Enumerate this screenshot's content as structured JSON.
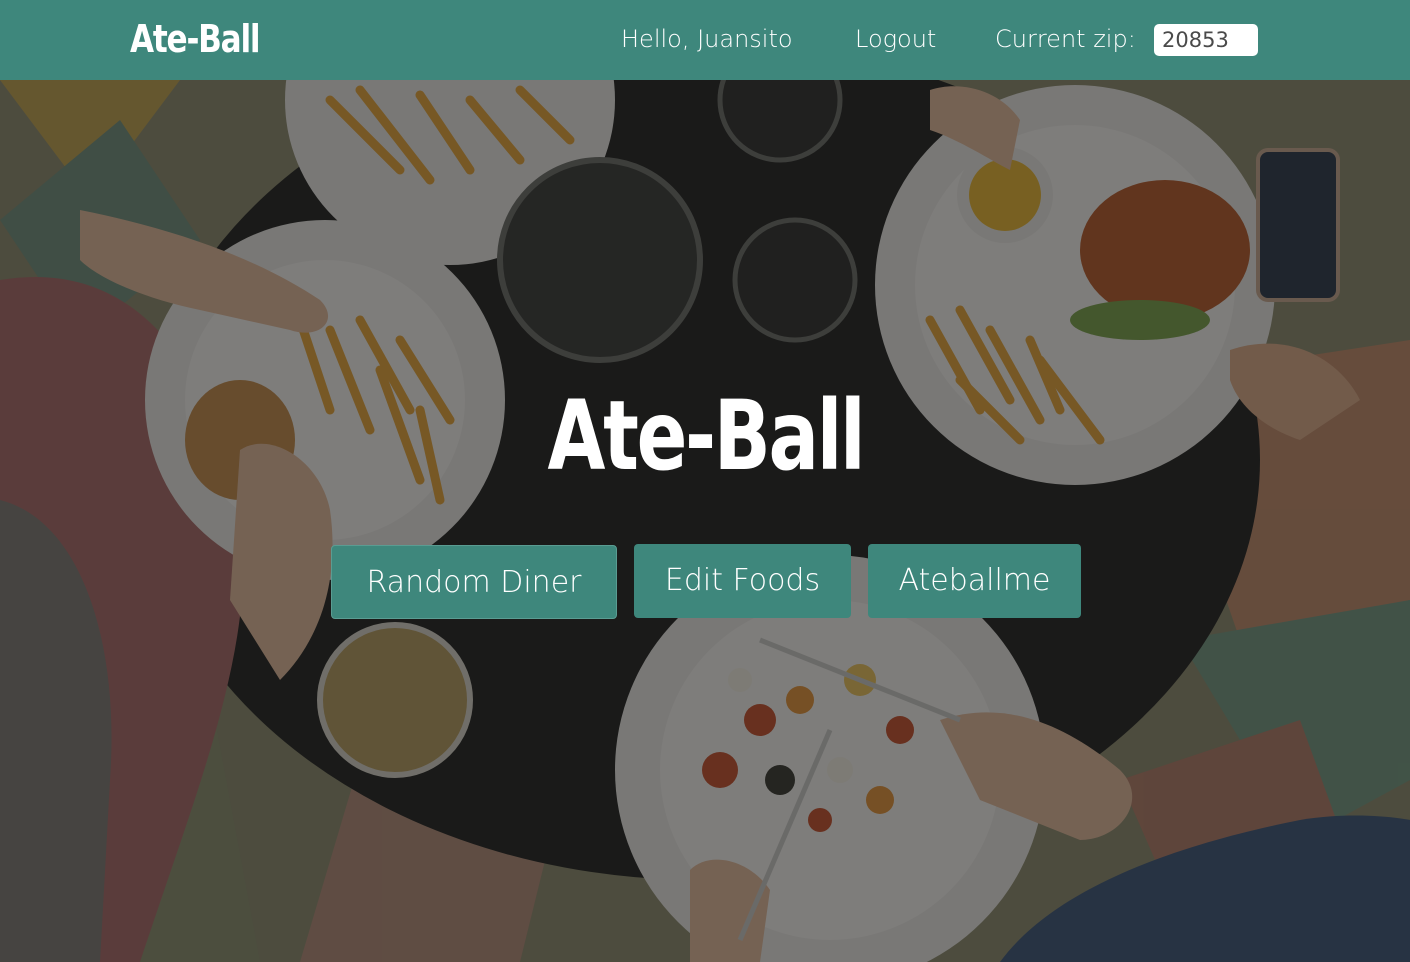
{
  "navbar": {
    "brand": "Ate-Ball",
    "greeting": "Hello, Juansito",
    "logout_label": "Logout",
    "zip_label": "Current zip:",
    "zip_value": "20853"
  },
  "hero": {
    "title": "Ate-Ball",
    "background_description_icon": "food-table-photo",
    "buttons": {
      "random_diner": "Random Diner",
      "edit_foods": "Edit Foods",
      "ateballme": "Ateballme"
    }
  },
  "colors": {
    "primary": "#3e877c",
    "text": "#ffffff"
  }
}
